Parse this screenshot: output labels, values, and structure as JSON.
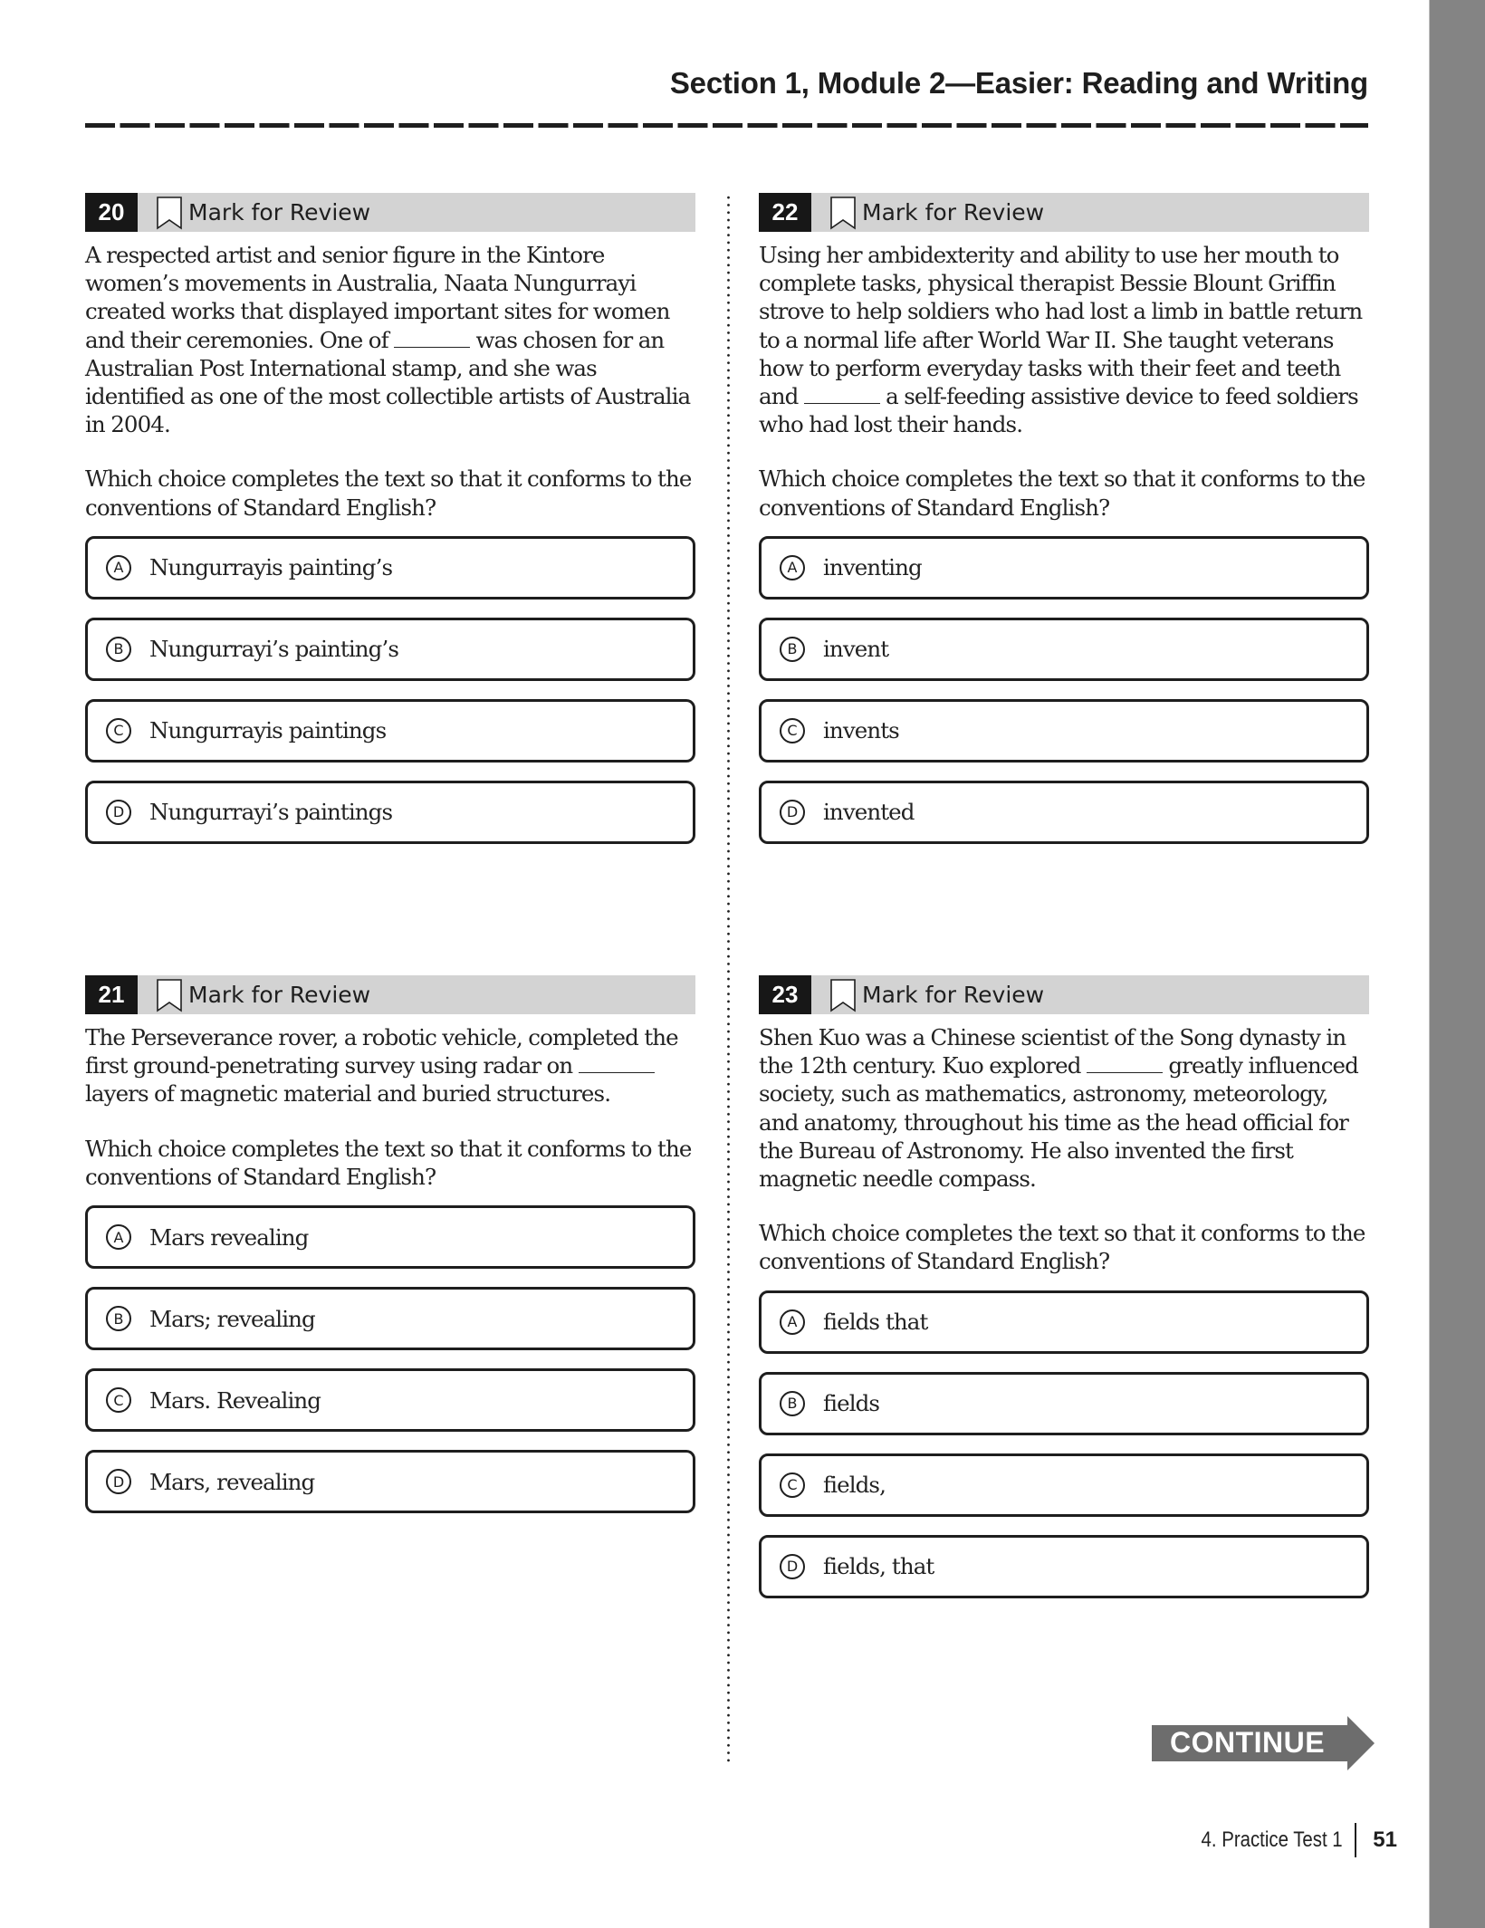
{
  "header": {
    "section_title": "Section 1, Module 2—Easier: Reading and Writing"
  },
  "questions": [
    {
      "number": "20",
      "mark_for_review": "Mark for Review",
      "passage_before": "A respected artist and senior figure in the Kintore women’s movements in Australia, Naata Nungurrayi created works that displayed important sites for women and their ceremonies. One of",
      "passage_after": "was chosen for an Australian Post International stamp, and she was identified as one of the most collectible artists of Australia in 2004.",
      "prompt": "Which choice completes the text so that it conforms to the conventions of Standard English?",
      "choices": [
        {
          "letter": "A",
          "text": "Nungurrayis painting’s"
        },
        {
          "letter": "B",
          "text": "Nungurrayi’s painting’s"
        },
        {
          "letter": "C",
          "text": "Nungurrayis paintings"
        },
        {
          "letter": "D",
          "text": "Nungurrayi’s paintings"
        }
      ]
    },
    {
      "number": "21",
      "mark_for_review": "Mark for Review",
      "passage_before": "The Perseverance rover, a robotic vehicle, completed the first ground-penetrating survey using radar on",
      "passage_after": "layers of magnetic material and buried structures.",
      "prompt": "Which choice completes the text so that it conforms to the conventions of Standard English?",
      "choices": [
        {
          "letter": "A",
          "text": "Mars revealing"
        },
        {
          "letter": "B",
          "text": "Mars; revealing"
        },
        {
          "letter": "C",
          "text": "Mars. Revealing"
        },
        {
          "letter": "D",
          "text": "Mars, revealing"
        }
      ]
    },
    {
      "number": "22",
      "mark_for_review": "Mark for Review",
      "passage_before": "Using her ambidexterity and ability to use her mouth to complete tasks, physical therapist Bessie Blount Griffin strove to help soldiers who had lost a limb in battle return to a normal life after World War II. She taught veterans how to perform everyday tasks with their feet and teeth and",
      "passage_after": "a self-feeding assistive device to feed soldiers who had lost their hands.",
      "prompt": "Which choice completes the text so that it conforms to the conventions of Standard English?",
      "choices": [
        {
          "letter": "A",
          "text": "inventing"
        },
        {
          "letter": "B",
          "text": "invent"
        },
        {
          "letter": "C",
          "text": "invents"
        },
        {
          "letter": "D",
          "text": "invented"
        }
      ]
    },
    {
      "number": "23",
      "mark_for_review": "Mark for Review",
      "passage_before": "Shen Kuo was a Chinese scientist of the Song dynasty in the 12th century. Kuo explored",
      "passage_after": "greatly influenced society, such as mathematics, astronomy, meteorology, and anatomy, throughout his time as the head official for the Bureau of Astronomy. He also invented the first magnetic needle compass.",
      "prompt": "Which choice completes the text so that it conforms to the conventions of Standard English?",
      "choices": [
        {
          "letter": "A",
          "text": "fields that"
        },
        {
          "letter": "B",
          "text": "fields"
        },
        {
          "letter": "C",
          "text": "fields,"
        },
        {
          "letter": "D",
          "text": "fields, that"
        }
      ]
    }
  ],
  "continue_label": "CONTINUE",
  "footer": {
    "chapter": "4.  Practice Test 1",
    "page_number": "51"
  },
  "colors": {
    "header_bar": "#d3d3d3",
    "number_badge": "#171717",
    "continue_arrow": "#6d6d6d",
    "side_strip": "#848484"
  }
}
